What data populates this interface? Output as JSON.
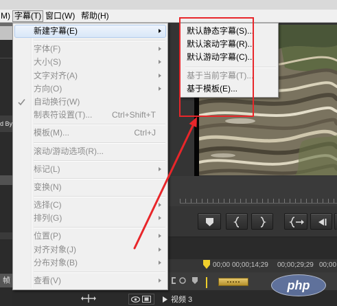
{
  "window": {
    "menubar": [
      {
        "label": "M)"
      },
      {
        "label": "字幕(T)",
        "active": true
      },
      {
        "label": "窗口(W)"
      },
      {
        "label": "帮助(H)"
      }
    ]
  },
  "title_menu": {
    "items": [
      {
        "label": "新建字幕(E)",
        "has_submenu": true,
        "enabled": true,
        "highlighted": true
      },
      {
        "label": "字体(F)",
        "has_submenu": true,
        "enabled": false
      },
      {
        "label": "大小(S)",
        "has_submenu": true,
        "enabled": false
      },
      {
        "label": "文字对齐(A)",
        "has_submenu": true,
        "enabled": false
      },
      {
        "label": "方向(O)",
        "has_submenu": true,
        "enabled": false
      },
      {
        "label": "自动换行(W)",
        "checked": true,
        "icon": "check-icon",
        "enabled": false
      },
      {
        "label": "制表符设置(T)...",
        "shortcut": "Ctrl+Shift+T",
        "enabled": false
      },
      {
        "label": "模板(M)...",
        "shortcut": "Ctrl+J",
        "enabled": false
      },
      {
        "label": "滚动/游动选项(R)...",
        "enabled": false
      },
      {
        "label": "标记(L)",
        "has_submenu": true,
        "enabled": false
      },
      {
        "label": "变换(N)",
        "enabled": false
      },
      {
        "label": "选择(C)",
        "has_submenu": true,
        "enabled": false
      },
      {
        "label": "排列(G)",
        "has_submenu": true,
        "enabled": false
      },
      {
        "label": "位置(P)",
        "has_submenu": true,
        "enabled": false
      },
      {
        "label": "对齐对象(J)",
        "has_submenu": true,
        "enabled": false
      },
      {
        "label": "分布对象(B)",
        "has_submenu": true,
        "enabled": false
      },
      {
        "label": "查看(V)",
        "has_submenu": true,
        "enabled": false
      }
    ]
  },
  "new_title_submenu": {
    "items": [
      {
        "label": "默认静态字幕(S)...",
        "enabled": true
      },
      {
        "label": "默认滚动字幕(R)...",
        "enabled": true
      },
      {
        "label": "默认游动字幕(C)...",
        "enabled": true
      },
      {
        "label": "基于当前字幕(T)...",
        "enabled": false
      },
      {
        "label": "基于模板(E)...",
        "enabled": true
      }
    ]
  },
  "program_monitor": {
    "buttons": [
      "add-marker-icon",
      "mark-in-icon",
      "mark-out-icon",
      "go-to-in-icon",
      "step-back-icon"
    ]
  },
  "timeline": {
    "timecodes": [
      "00;00",
      "00;00;14;29",
      "00;00;29;29",
      "00;00"
    ],
    "tracks": [
      {
        "label": "视频 3"
      }
    ],
    "tools": [
      "snap-icon",
      "add-marker-icon",
      "marker-icon"
    ]
  },
  "side_panel": {
    "labels": [
      "d By",
      "帧"
    ]
  },
  "watermark": {
    "text": "php"
  },
  "theme": {
    "menu_bg": "#f0f0f0",
    "menu_highlight": "#d9e7f8",
    "disabled_text": "#8d8d8d",
    "annotation_red": "#e8262a",
    "playhead_yellow": "#f0cf2c",
    "work_area_gold": "#d2ad45"
  }
}
